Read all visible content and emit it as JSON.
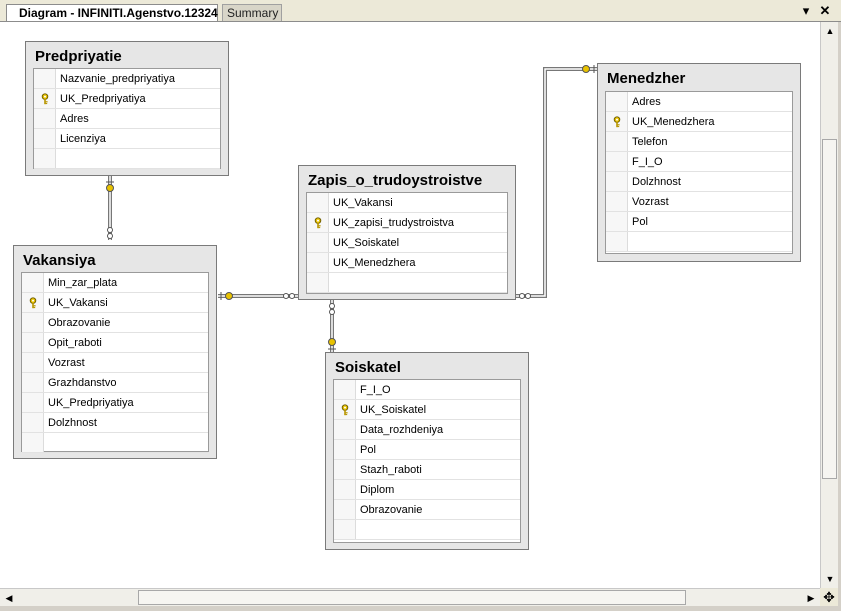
{
  "tabs": {
    "active_label": "Diagram - INFINITI.Agenstvo.12324",
    "summary_label": "Summary"
  },
  "toolbar": {
    "dropdown_glyph": "▾",
    "close_glyph": "✕"
  },
  "tables": {
    "predpriyatie": {
      "title": "Predpriyatie",
      "columns": [
        {
          "name": "Nazvanie_predpriyatiya",
          "key": false
        },
        {
          "name": "UK_Predpriyatiya",
          "key": true
        },
        {
          "name": "Adres",
          "key": false
        },
        {
          "name": "Licenziya",
          "key": false
        }
      ]
    },
    "menedzher": {
      "title": "Menedzher",
      "columns": [
        {
          "name": "Adres",
          "key": false
        },
        {
          "name": "UK_Menedzhera",
          "key": true
        },
        {
          "name": "Telefon",
          "key": false
        },
        {
          "name": "F_I_O",
          "key": false
        },
        {
          "name": "Dolzhnost",
          "key": false
        },
        {
          "name": "Vozrast",
          "key": false
        },
        {
          "name": "Pol",
          "key": false
        }
      ]
    },
    "zapis": {
      "title": "Zapis_o_trudoystroistve",
      "columns": [
        {
          "name": "UK_Vakansi",
          "key": false
        },
        {
          "name": "UK_zapisi_trudystroistva",
          "key": true
        },
        {
          "name": "UK_Soiskatel",
          "key": false
        },
        {
          "name": "UK_Menedzhera",
          "key": false
        }
      ]
    },
    "vakansiya": {
      "title": "Vakansiya",
      "columns": [
        {
          "name": "Min_zar_plata",
          "key": false
        },
        {
          "name": "UK_Vakansi",
          "key": true
        },
        {
          "name": "Obrazovanie",
          "key": false
        },
        {
          "name": "Opit_raboti",
          "key": false
        },
        {
          "name": "Vozrast",
          "key": false
        },
        {
          "name": "Grazhdanstvo",
          "key": false
        },
        {
          "name": "UK_Predpriyatiya",
          "key": false
        },
        {
          "name": "Dolzhnost",
          "key": false
        }
      ]
    },
    "soiskatel": {
      "title": "Soiskatel",
      "columns": [
        {
          "name": "F_I_O",
          "key": false
        },
        {
          "name": "UK_Soiskatel",
          "key": true
        },
        {
          "name": "Data_rozhdeniya",
          "key": false
        },
        {
          "name": "Pol",
          "key": false
        },
        {
          "name": "Stazh_raboti",
          "key": false
        },
        {
          "name": "Diplom",
          "key": false
        },
        {
          "name": "Obrazovanie",
          "key": false
        }
      ]
    }
  },
  "relationships": [
    {
      "from": "predpriyatie",
      "to": "vakansiya"
    },
    {
      "from": "vakansiya",
      "to": "zapis"
    },
    {
      "from": "menedzher",
      "to": "zapis"
    },
    {
      "from": "soiskatel",
      "to": "zapis"
    }
  ],
  "scrollbars": {
    "vertical_position": 0.05,
    "horizontal_position": 0.2
  },
  "colors": {
    "key_icon": "#e8c200",
    "connector_key": "#e8c200",
    "table_frame": "#e6e6e6"
  }
}
